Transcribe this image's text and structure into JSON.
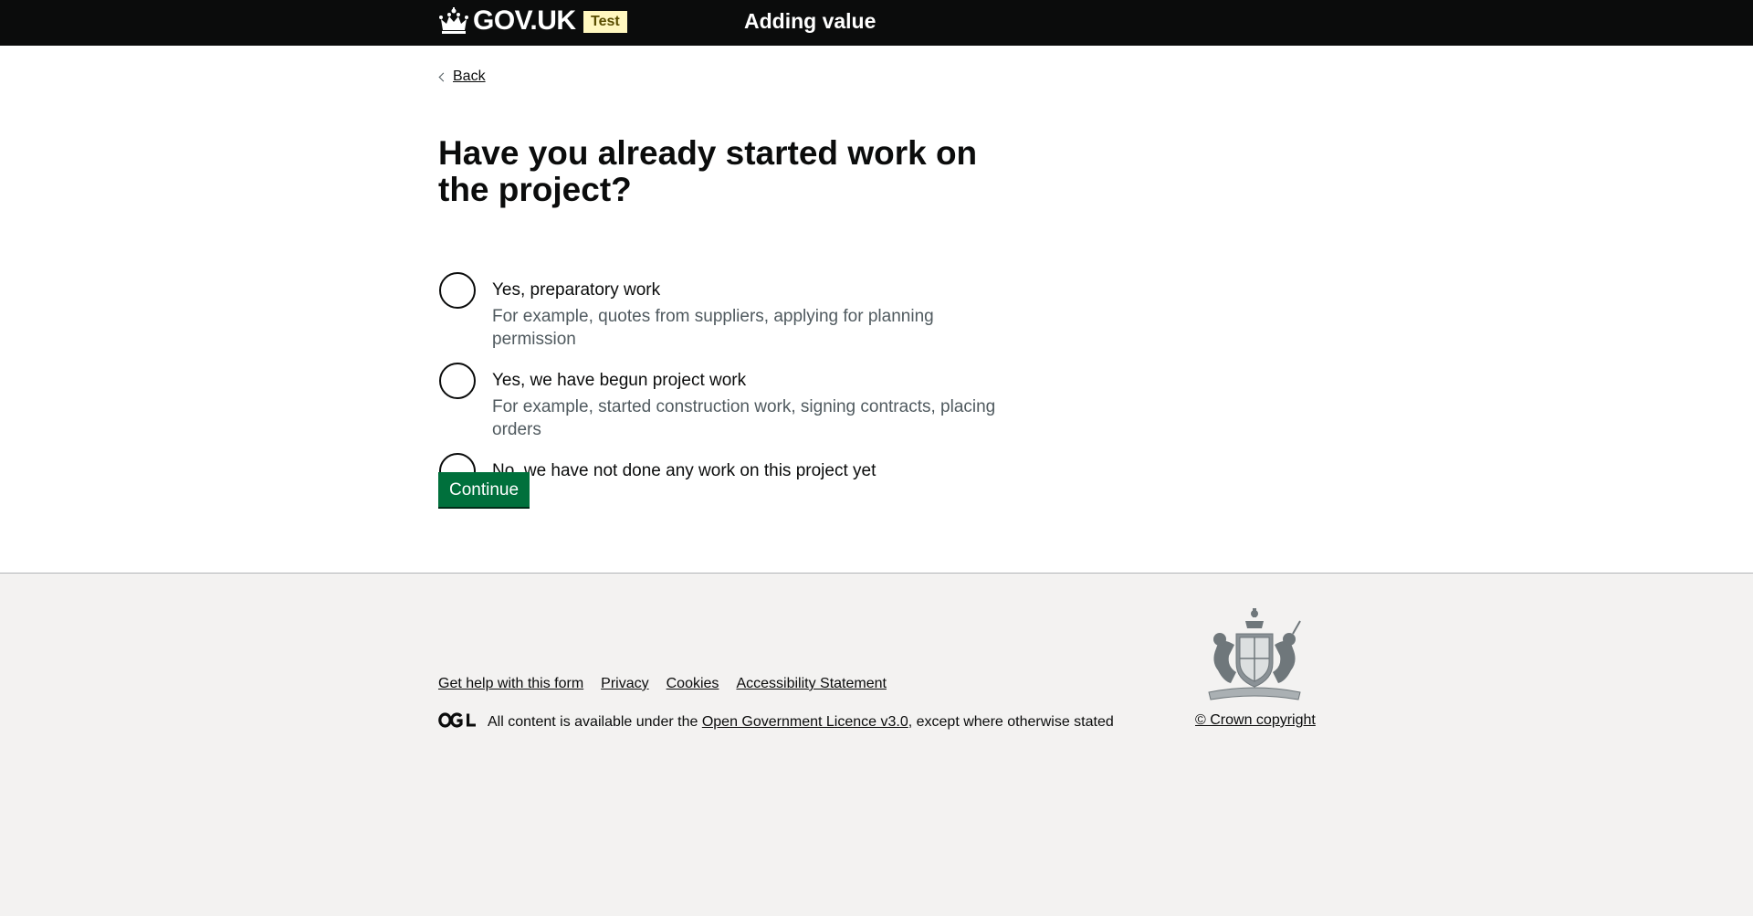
{
  "header": {
    "logo_text": "GOV.UK",
    "tag": "Test",
    "service_name": "Adding value"
  },
  "navigation": {
    "back_label": "Back"
  },
  "question": {
    "heading": "Have you already started work on the project?",
    "options": [
      {
        "label": "Yes, preparatory work",
        "hint": "For example, quotes from suppliers, applying for planning permission",
        "selected": false
      },
      {
        "label": "Yes, we have begun project work",
        "hint": "For example, started construction work, signing contracts, placing orders",
        "selected": false
      },
      {
        "label": "No, we have not done any work on this project yet",
        "hint": "",
        "selected": false
      }
    ]
  },
  "actions": {
    "continue_label": "Continue"
  },
  "footer": {
    "links": [
      "Get help with this form",
      "Privacy",
      "Cookies",
      "Accessibility Statement"
    ],
    "licence_prefix": "All content is available under the",
    "licence_link": "Open Government Licence v3.0",
    "licence_suffix": ", except where otherwise stated",
    "copyright": "© Crown copyright"
  },
  "colors": {
    "header_bg": "#0b0c0c",
    "accent_bar": "#1d70b8",
    "button_green": "#00703c",
    "footer_bg": "#f3f2f1",
    "tag_bg": "#fff7bf"
  },
  "icons": [
    "crown-icon",
    "back-chevron-icon",
    "ogl-logo-icon",
    "royal-crest-icon"
  ]
}
